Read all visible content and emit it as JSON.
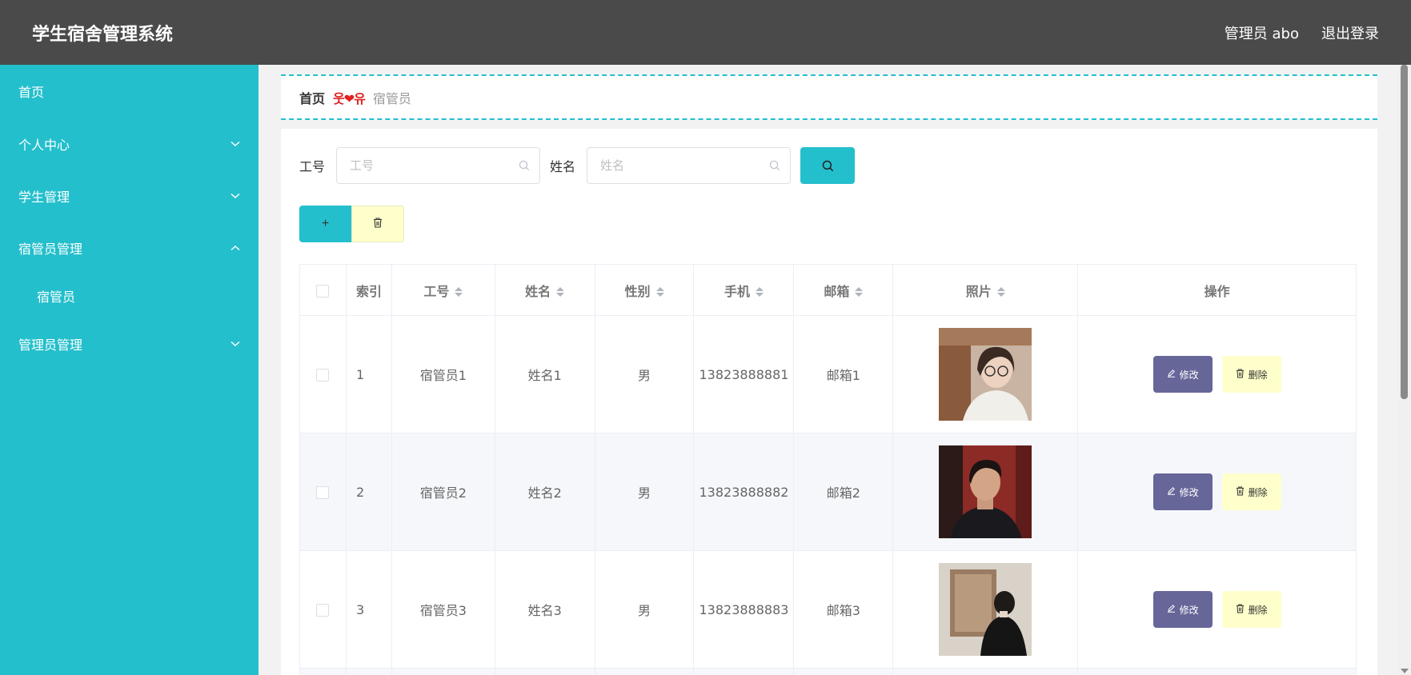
{
  "header": {
    "title": "学生宿舍管理系统",
    "user_label": "管理员 abo",
    "logout_label": "退出登录"
  },
  "sidebar": {
    "items": [
      {
        "label": "首页",
        "expandable": false
      },
      {
        "label": "个人中心",
        "expandable": true,
        "expanded": false
      },
      {
        "label": "学生管理",
        "expandable": true,
        "expanded": false
      },
      {
        "label": "宿管员管理",
        "expandable": true,
        "expanded": true,
        "children": [
          {
            "label": "宿管员"
          }
        ]
      },
      {
        "label": "管理员管理",
        "expandable": true,
        "expanded": false
      }
    ]
  },
  "breadcrumb": {
    "home": "首页",
    "separator": "웃❤유",
    "current": "宿管员"
  },
  "search": {
    "field1_label": "工号",
    "field1_placeholder": "工号",
    "field2_label": "姓名",
    "field2_placeholder": "姓名"
  },
  "actions": {
    "add_label": "+"
  },
  "table": {
    "columns": [
      "索引",
      "工号",
      "姓名",
      "性别",
      "手机",
      "邮箱",
      "照片",
      "操作"
    ],
    "rows": [
      {
        "index": "1",
        "id": "宿管员1",
        "name": "姓名1",
        "gender": "男",
        "phone": "13823888881",
        "email": "邮箱1",
        "photo": "portrait-woman-glasses"
      },
      {
        "index": "2",
        "id": "宿管员2",
        "name": "姓名2",
        "gender": "男",
        "phone": "13823888882",
        "email": "邮箱2",
        "photo": "portrait-man-red-background"
      },
      {
        "index": "3",
        "id": "宿管员3",
        "name": "姓名3",
        "gender": "男",
        "phone": "13823888883",
        "email": "邮箱3",
        "photo": "portrait-man-back-view"
      }
    ],
    "edit_label": "修改",
    "delete_label": "删除"
  },
  "colors": {
    "header_bg": "#4a4a4a",
    "sidebar_bg": "#24bfcc",
    "accent": "#24bfcc",
    "edit_button": "#666699",
    "delete_button": "#ffffcc",
    "breadcrumb_separator": "#e02020"
  }
}
